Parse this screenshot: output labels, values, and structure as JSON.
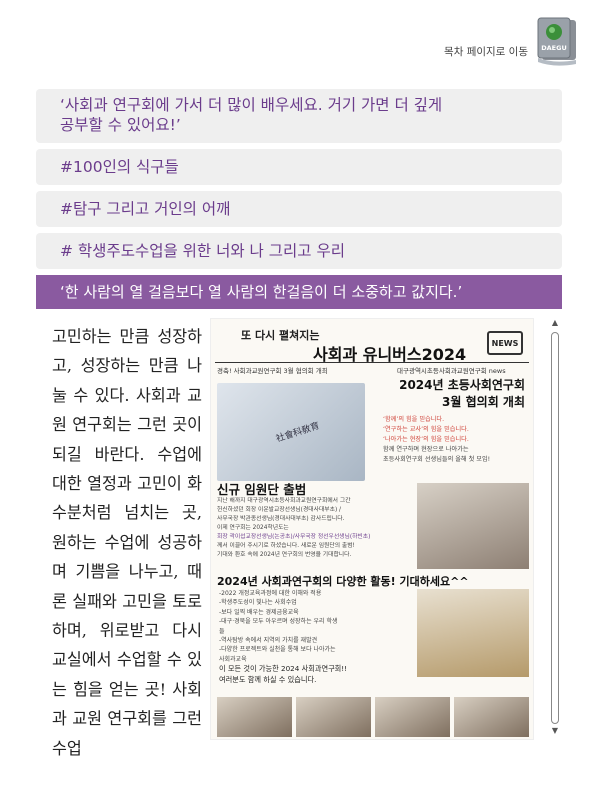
{
  "header": {
    "toc_link": "목차 페이지로 이동",
    "book_icon": "book-icon",
    "book_badge": "DAEGU"
  },
  "sections": [
    {
      "line1": "‘사회과 연구회에 가서 더 많이 배우세요. 거기 가면 더 깊게",
      "line2": "공부할 수 있어요!’"
    },
    {
      "label": "#100인의 식구들"
    },
    {
      "label": "#탐구 그리고 거인의 어깨"
    },
    {
      "label": "# 학생주도수업을 위한 너와 나 그리고 우리"
    },
    {
      "label": "‘한 사람의 열 걸음보다 열 사람의 한걸음이 더 소중하고 값지다.’"
    }
  ],
  "body_text": "고민하는 만큼 성장하고, 성장하는 만큼 나눌 수 있다. 사회과 교원 연구회는 그런 곳이 되길 바란다. 수업에 대한 열정과 고민이 화수분처럼 넘치는 곳, 원하는 수업에 성공하며 기쁨을 나누고, 때론 실패와 고민을 토로하며, 위로받고 다시 교실에서 수업할 수 있는 힘을 얻는 곳! 사회과 교원 연구회를 그런 수업",
  "newsletter": {
    "title_small": "또 다시 펼쳐지는",
    "title_large": "사회과 유니버스2024",
    "news_badge": "NEWS",
    "subtitle_left": "경축! 사회과교원연구회 3월 협의회 개최",
    "subtitle_right": "대구광역시초등사회과교원연구회 news",
    "book_spine": "社會科敎育",
    "meeting_heading_1": "2024년 초등사회연구회",
    "meeting_heading_2": "3월 협의회 개최",
    "meeting_lines": [
      "‘함께’의 힘을 믿습니다.",
      "‘연구하는 교사’의 힘을 믿습니다.",
      "‘나아가는 현장’의 힘을 믿습니다.",
      "함께 연구하며 현장으로 나아가는",
      "초등사회연구회 선생님들의 올해 첫 모임!"
    ],
    "officers_heading": "신규 임원단 출범",
    "officers_lines": [
      "지난 해까지 대구광역시초등사회과교원연구회에서 그간",
      "헌신하셨던 회장 이운발교장선생님(경대사대부초) /",
      "사무국장 박관종선생님(경대사대부초) 감사드립니다.",
      "이제 연구회는 2024학년도는",
      "회장 곽이섭교장선생님(논공초)/사무국장 정선우선생님(하빈초)",
      "께서 이끌어 주시기로 하셨습니다. 새로운 임원단의 출범!",
      "기대와 환호 속에 2024년 연구회의 번영을 기대합니다."
    ],
    "activities_heading": "2024년 사회과연구회의 다양한 활동! 기대하세요^^",
    "activities_lines": [
      "-2022 개정교육과정에 대한 이해와 적용",
      "-학생주도성이 빛나는 사회수업",
      "-보다 일찍 배우는 경제금융교육",
      "-대구·경북을 모두 아우르며 성장하는 우리 학생들",
      "-역사탐방 속에서 지역의 가치를 재발견",
      "-다양한 프로젝트와 실천을 통해 보다 나아가는 사회과교육"
    ],
    "closing_1": "이 모든 것이 가능한 2024 사회과연구회!!",
    "closing_2": "여러분도 함께 하실 수 있습니다."
  },
  "scrollbar": {
    "up": "▲",
    "down": "▼"
  }
}
